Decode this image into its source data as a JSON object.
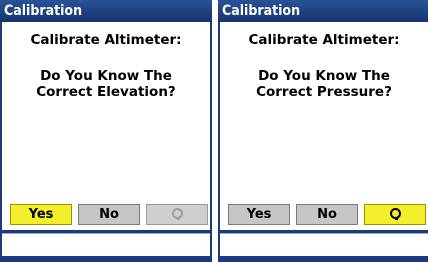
{
  "left": {
    "title": "Calibration",
    "heading": "Calibrate Altimeter:",
    "question_line1": "Do You Know The",
    "question_line2": "Correct Elevation?",
    "buttons": {
      "yes": "Yes",
      "no": "No",
      "reset_icon": "reset-icon",
      "selected": "yes",
      "reset_enabled": false
    }
  },
  "right": {
    "title": "Calibration",
    "heading": "Calibrate Altimeter:",
    "question_line1": "Do You Know The",
    "question_line2": "Correct Pressure?",
    "buttons": {
      "yes": "Yes",
      "no": "No",
      "reset_icon": "reset-icon",
      "selected": "reset",
      "reset_enabled": true
    }
  },
  "colors": {
    "title_bar": "#1d3b7a",
    "selected_button": "#f3ef2a",
    "button": "#c6c6c6"
  }
}
